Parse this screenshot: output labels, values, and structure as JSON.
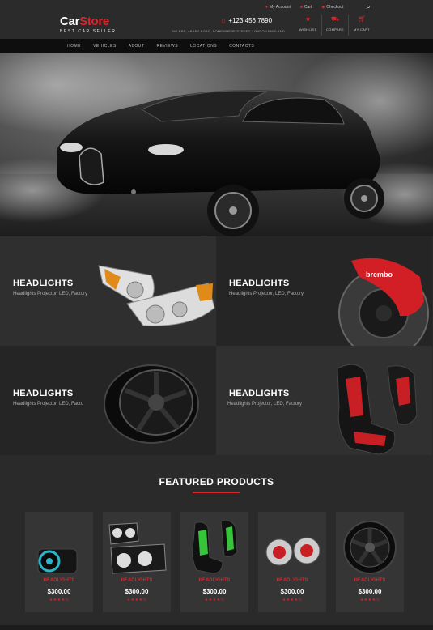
{
  "header": {
    "logo_main": "Car",
    "logo_accent": "Store",
    "logo_tagline": "BEST CAR SELLER",
    "toplinks": [
      {
        "icon": "user-icon",
        "label": "My Account"
      },
      {
        "icon": "cart-icon",
        "label": "Cart"
      },
      {
        "icon": "checkout-icon",
        "label": "Checkout"
      }
    ],
    "phone": "+123 456 7890",
    "address": "BIG BEN, ABBEY ROAD, SOMEWHERE STREET, LONDON ENGLAND",
    "icons": [
      {
        "icon": "star-icon",
        "label": "WISHLIST"
      },
      {
        "icon": "car-icon",
        "label": "COMPARE"
      },
      {
        "icon": "cart-icon",
        "label": "MY CART"
      }
    ]
  },
  "nav": [
    "HOME",
    "VEHICLES",
    "ABOUT",
    "REVIEWS",
    "LOCATIONS",
    "CONTACTS"
  ],
  "tiles": [
    {
      "title": "HEADLIGHTS",
      "subtitle": "Headlights Projector, LED, Factory"
    },
    {
      "title": "HEADLIGHTS",
      "subtitle": "Headlights Projector, LED, Factory"
    },
    {
      "title": "HEADLIGHTS",
      "subtitle": "Headlights Projector, LED, Facto"
    },
    {
      "title": "HEADLIGHTS",
      "subtitle": "Headlights Projector, LED, Factory"
    }
  ],
  "featured": {
    "title": "FEATURED PRODUCTS",
    "products": [
      {
        "name": "HEADLIGHTS",
        "price": "$300.00",
        "rating": 4.5
      },
      {
        "name": "HEADLIGHTS",
        "price": "$300.00",
        "rating": 4.5
      },
      {
        "name": "HEADLIGHTS",
        "price": "$300.00",
        "rating": 4.5
      },
      {
        "name": "HEADLIGHTS",
        "price": "$300.00",
        "rating": 4.5
      },
      {
        "name": "HEADLIGHTS",
        "price": "$300.00",
        "rating": 4.5
      }
    ]
  },
  "colors": {
    "accent": "#d9252c",
    "background": "#2a2a2a",
    "nav": "#0e0e0e"
  }
}
